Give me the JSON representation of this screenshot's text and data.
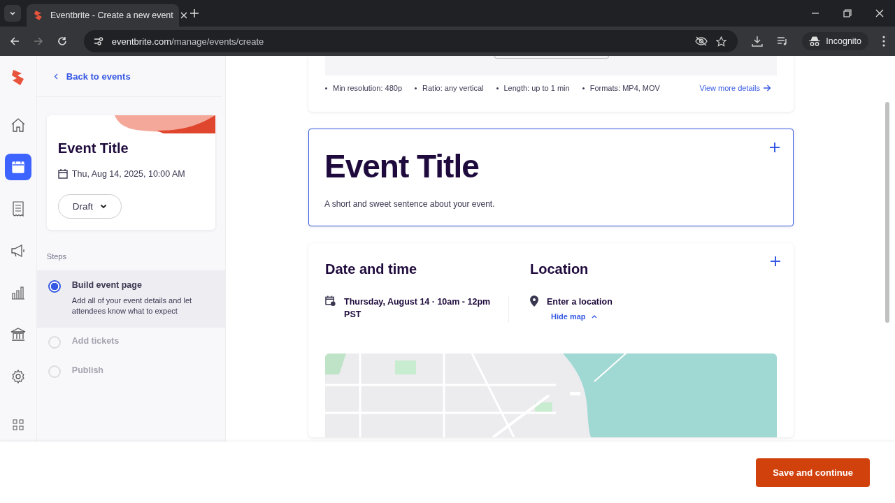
{
  "browser": {
    "tab_title": "Eventbrite - Create a new event",
    "url_host": "eventbrite.com",
    "url_path": "/manage/events/create",
    "profile": "Incognito"
  },
  "rail": [
    {
      "kind": "home",
      "selected": false
    },
    {
      "kind": "calendar",
      "selected": true
    },
    {
      "kind": "receipt",
      "selected": false
    },
    {
      "kind": "megaphone",
      "selected": false
    },
    {
      "kind": "chart",
      "selected": false
    },
    {
      "kind": "bank",
      "selected": false
    },
    {
      "kind": "gear",
      "selected": false
    },
    {
      "kind": "apps",
      "selected": false
    }
  ],
  "sidebar": {
    "back_link": "Back to events",
    "event_card": {
      "title": "Event Title",
      "date": "Thu, Aug 14, 2025, 10:00 AM",
      "status": "Draft"
    },
    "steps_heading": "Steps",
    "steps": [
      {
        "label": "Build event page",
        "description": "Add all of your event details and let attendees know what to expect",
        "selected": true,
        "disabled": false
      },
      {
        "label": "Add tickets",
        "selected": false,
        "disabled": true
      },
      {
        "label": "Publish",
        "selected": false,
        "disabled": true
      }
    ]
  },
  "media_requirements": {
    "items": [
      "Min resolution: 480p",
      "Ratio: any vertical",
      "Length: up to 1 min",
      "Formats: MP4, MOV"
    ],
    "link": "View more details"
  },
  "title_card": {
    "title": "Event Title",
    "summary": "A short and sweet sentence about your event."
  },
  "details_card": {
    "date_heading": "Date and time",
    "date_value": "Thursday, August 14 · 10am - 12pm PST",
    "location_heading": "Location",
    "location_value": "Enter a location",
    "map_toggle": "Hide map"
  },
  "footer": {
    "save_button": "Save and continue"
  }
}
